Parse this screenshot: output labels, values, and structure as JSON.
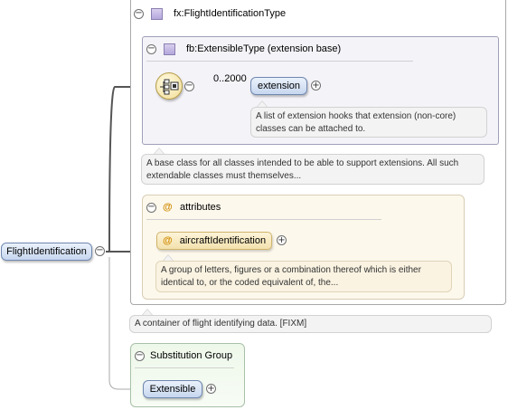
{
  "root_element": {
    "label": "FlightIdentification"
  },
  "type": {
    "label": "fx:FlightIdentificationType",
    "extension_base": {
      "label": "fb:ExtensibleType (extension base)",
      "cardinality": "0..2000",
      "element_label": "extension",
      "element_note": "A list of extension hooks that extension (non-core) classes can be attached to.",
      "note": "A base class for all classes intended to be able to support extensions. All such extendable classes must themselves..."
    },
    "attributes": {
      "label": "attributes",
      "attribute_label": "aircraftIdentification",
      "attribute_note": "A group of letters, figures or a combination thereof which is either identical to, or the coded equivalent of, the..."
    }
  },
  "element_note": "A container of flight identifying data. [FIXM]",
  "substitution_group": {
    "label": "Substitution Group",
    "member_label": "Extensible"
  },
  "icons": {
    "collapse": "collapse-icon",
    "expand": "expand-icon",
    "complex_type": "complex-type-icon",
    "sequence": "sequence-compositor-icon",
    "attribute": "attribute-icon"
  },
  "symbols": {
    "collapse": "−",
    "expand": "+",
    "attribute": "@"
  },
  "colors": {
    "element_fill": "#c7d7ef",
    "type_icon": "#b3a6dc",
    "attribute_fill": "#f3e2ad",
    "substitution_fill": "#eef8ea",
    "connector": "#555555"
  }
}
